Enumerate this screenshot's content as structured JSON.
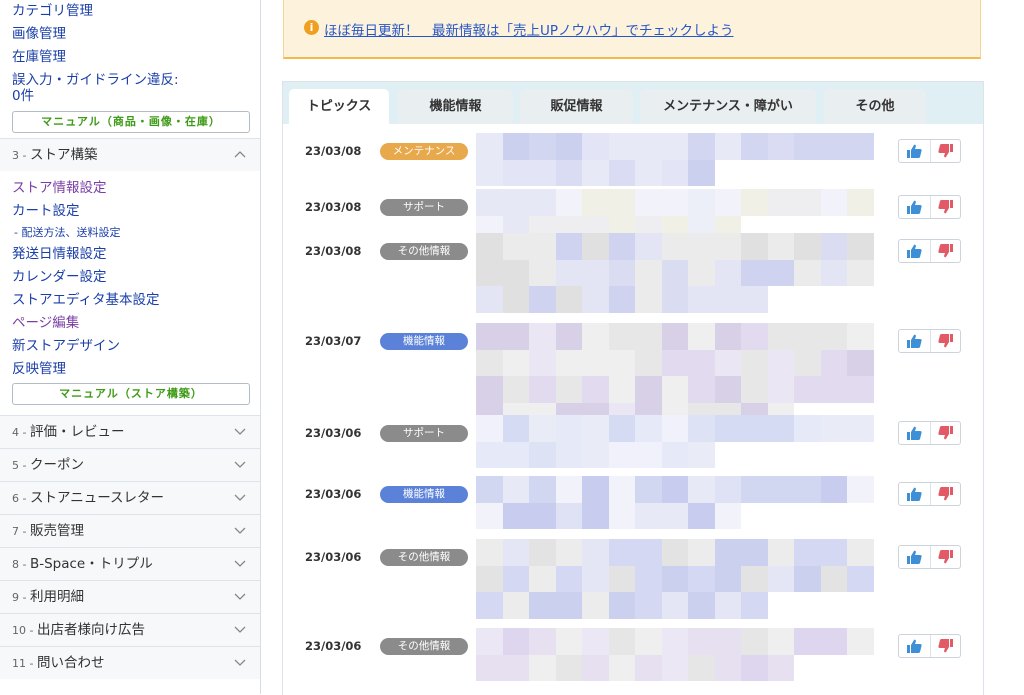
{
  "sidebar": {
    "top_links": [
      {
        "label": "カテゴリ管理"
      },
      {
        "label": "画像管理"
      },
      {
        "label": "在庫管理"
      },
      {
        "label": "誤入力・ガイドライン違反:\n0件"
      }
    ],
    "manual_product": "マニュアル（商品・画像・在庫）",
    "section3": {
      "num": "3 - ",
      "label": "ストア構築"
    },
    "store_links": [
      {
        "label": "ストア情報設定",
        "visited": true
      },
      {
        "label": "カート設定",
        "visited": false
      },
      {
        "label": "- 配送方法、送料設定",
        "sub": true
      },
      {
        "label": "発送日情報設定",
        "visited": false
      },
      {
        "label": "カレンダー設定",
        "visited": false
      },
      {
        "label": "ストアエディタ基本設定",
        "visited": false
      },
      {
        "label": "ページ編集",
        "visited": true
      },
      {
        "label": "新ストアデザイン",
        "visited": false
      },
      {
        "label": "反映管理",
        "visited": false
      }
    ],
    "manual_store": "マニュアル（ストア構築）",
    "sections": [
      {
        "num": "4 - ",
        "label": "評価・レビュー"
      },
      {
        "num": "5 - ",
        "label": "クーポン"
      },
      {
        "num": "6 - ",
        "label": "ストアニュースレター"
      },
      {
        "num": "7 - ",
        "label": "販売管理"
      },
      {
        "num": "8 - ",
        "label": "B-Space・トリプル"
      },
      {
        "num": "9 - ",
        "label": "利用明細"
      },
      {
        "num": "10 - ",
        "label": "出店者様向け広告"
      },
      {
        "num": "11 - ",
        "label": "問い合わせ"
      }
    ]
  },
  "notice": {
    "icon": "info-icon",
    "text": "ほぼ毎日更新！　最新情報は「売上UPノウハウ」でチェックしよう"
  },
  "tabs": [
    {
      "label": "トピックス",
      "active": true
    },
    {
      "label": "機能情報"
    },
    {
      "label": "販促情報"
    },
    {
      "label": "メンテナンス・障がい"
    },
    {
      "label": "その他"
    }
  ],
  "news": [
    {
      "date": "23/03/08",
      "category": "メンテナンス",
      "kind": "maint"
    },
    {
      "date": "23/03/08",
      "category": "サポート",
      "kind": "support"
    },
    {
      "date": "23/03/08",
      "category": "その他情報",
      "kind": "other"
    },
    {
      "date": "23/03/07",
      "category": "機能情報",
      "kind": "func"
    },
    {
      "date": "23/03/06",
      "category": "サポート",
      "kind": "support"
    },
    {
      "date": "23/03/06",
      "category": "機能情報",
      "kind": "func"
    },
    {
      "date": "23/03/06",
      "category": "その他情報",
      "kind": "other"
    },
    {
      "date": "23/03/06",
      "category": "その他情報",
      "kind": "other"
    }
  ],
  "colors": {
    "thumb_up": "#3d8fd6",
    "thumb_down": "#e25a66",
    "accent_blue": "#1a3fa8",
    "notice_bg": "#fdf3dc"
  }
}
